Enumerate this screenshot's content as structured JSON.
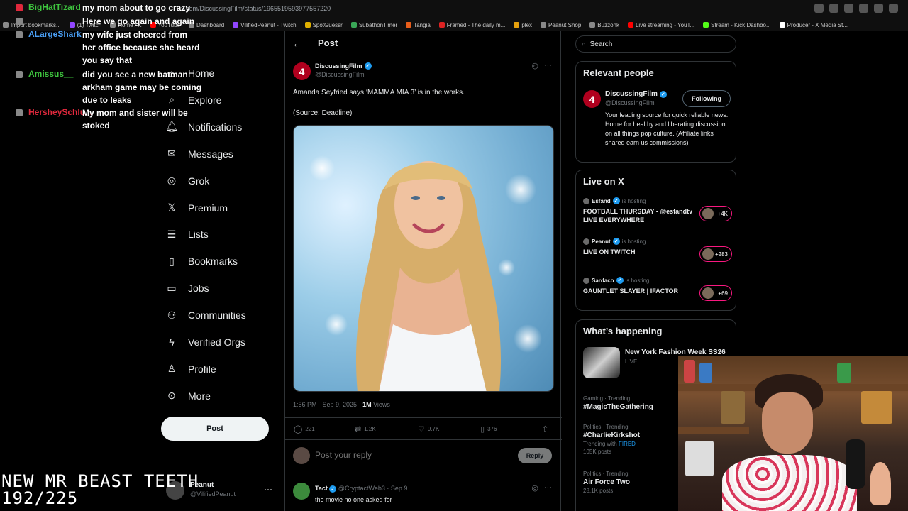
{
  "browser": {
    "url": "x.com/DiscussingFilm/status/1965519593977557220",
    "bookmarks": [
      {
        "label": "Import bookmarks...",
        "color": "#8a8a8a"
      },
      {
        "label": "(1) Twitch",
        "color": "#9146ff"
      },
      {
        "label": "Home / X",
        "color": "#888888"
      },
      {
        "label": "YouTube",
        "color": "#ff0000"
      },
      {
        "label": "Dashboard",
        "color": "#888888"
      },
      {
        "label": "VilifiedPeanut - Twitch",
        "color": "#9146ff"
      },
      {
        "label": "SpotGuessr",
        "color": "#e0b000"
      },
      {
        "label": "SubathonTimer",
        "color": "#3aa757"
      },
      {
        "label": "Tangia",
        "color": "#e85d1a"
      },
      {
        "label": "Framed - The daily m...",
        "color": "#d22"
      },
      {
        "label": "plex",
        "color": "#e5a00d"
      },
      {
        "label": "Peanut Shop",
        "color": "#888888"
      },
      {
        "label": "Buzzonk",
        "color": "#888888"
      },
      {
        "label": "Live streaming - YouT...",
        "color": "#ff0000"
      },
      {
        "label": "Stream - Kick Dashbo...",
        "color": "#53fc18"
      },
      {
        "label": "Producer - X Media St...",
        "color": "#ffffff"
      }
    ]
  },
  "chat": [
    {
      "user": "BigHatTizard",
      "color": "#3ec43e",
      "message": "my mom about to go crazy"
    },
    {
      "user": "",
      "color": "#9146ff",
      "message": "Here we go again and again"
    },
    {
      "user": "ALargeShark",
      "color": "#4a9ff5",
      "message": "my wife just cheered from her office because she heard you say that"
    },
    {
      "user": "Amissus__",
      "color": "#3ec43e",
      "message": "did you see a new batman arkham game may be coming due to leaks"
    },
    {
      "user": "HersheySchlu...",
      "color": "#e0283c",
      "message": "My mom and sister will be stoked"
    }
  ],
  "nav": {
    "items": [
      {
        "label": "Home",
        "icon": "home-icon"
      },
      {
        "label": "Explore",
        "icon": "search-icon"
      },
      {
        "label": "Notifications",
        "icon": "bell-icon"
      },
      {
        "label": "Messages",
        "icon": "mail-icon"
      },
      {
        "label": "Grok",
        "icon": "grok-icon"
      },
      {
        "label": "Premium",
        "icon": "x-logo-icon"
      },
      {
        "label": "Lists",
        "icon": "list-icon"
      },
      {
        "label": "Bookmarks",
        "icon": "bookmark-icon"
      },
      {
        "label": "Jobs",
        "icon": "briefcase-icon"
      },
      {
        "label": "Communities",
        "icon": "people-icon"
      },
      {
        "label": "Verified Orgs",
        "icon": "lightning-icon"
      },
      {
        "label": "Profile",
        "icon": "person-icon"
      },
      {
        "label": "More",
        "icon": "more-circle-icon"
      }
    ],
    "post_button": "Post",
    "account_name": "Peanut",
    "account_handle": "@VilifiedPeanut",
    "account_more": "···"
  },
  "post": {
    "header_title": "Post",
    "author_name": "DiscussingFilm",
    "author_handle": "@DiscussingFilm",
    "text": "Amanda Seyfried says ‘MAMMA MIA 3’ is in the works.",
    "source": "(Source: Deadline)",
    "time": "1:56 PM · Sep 9, 2025 · ",
    "views_count": "1M",
    "views_label": " Views",
    "replies": "221",
    "reposts": "1.2K",
    "likes": "9.7K",
    "bookmarks": "376",
    "reply_placeholder": "Post your reply",
    "reply_button": "Reply"
  },
  "comment": {
    "name": "Tact",
    "handle_date": "@CryptactWeb3 · Sep 9",
    "text": "the movie no one asked for"
  },
  "sidebar": {
    "search_placeholder": "Search",
    "relevant_title": "Relevant people",
    "relevant": {
      "name": "DiscussingFilm",
      "handle": "@DiscussingFilm",
      "follow_label": "Following",
      "bio": "Your leading source for quick reliable news. Home for healthy and liberating discussion on all things pop culture. (Affiliate links shared earn us commissions)"
    },
    "live_title": "Live on X",
    "live": [
      {
        "host": "Esfand",
        "hosting": "is hosting",
        "title": "FOOTBALL THURSDAY - @esfandtv LIVE EVERYWHERE",
        "count": "+4K"
      },
      {
        "host": "Peanut",
        "hosting": "is hosting",
        "title": "LIVE ON TWITCH",
        "count": "+283"
      },
      {
        "host": "Sardaco",
        "hosting": "is hosting",
        "title": "GAUNTLET SLAYER | IFACTOR",
        "count": "+69"
      }
    ],
    "happening_title": "What’s happening",
    "featured": {
      "name": "New York Fashion Week SS26",
      "status": "LIVE"
    },
    "trends": [
      {
        "category": "Gaming · Trending",
        "name": "#MagicTheGathering",
        "sub": "",
        "sub_extra": ""
      },
      {
        "category": "Politics · Trending",
        "name": "#CharlieKirkshot",
        "sub": "Trending with ",
        "sub_extra": "FIRED",
        "posts": "105K posts"
      },
      {
        "category": "Politics · Trending",
        "name": "Air Force Two",
        "sub": "28.1K posts",
        "sub_extra": ""
      }
    ]
  },
  "overlay": {
    "line1": "NEW MR BEAST TEETH",
    "line2": "192/225"
  },
  "colors": {
    "accent": "#1d9bf0",
    "background": "#000000",
    "border": "#2f3336",
    "muted": "#71767b"
  }
}
